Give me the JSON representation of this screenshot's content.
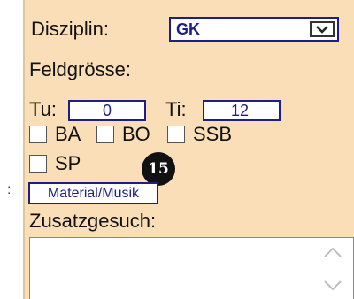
{
  "form": {
    "disziplin_label": "Disziplin:",
    "disziplin_value": "GK",
    "feldgroesse_label": "Feldgrösse:",
    "tu_label": "Tu:",
    "tu_value": "0",
    "ti_label": "Ti:",
    "ti_value": "12",
    "checkboxes": [
      {
        "label": "BA",
        "checked": false
      },
      {
        "label": "BO",
        "checked": false
      },
      {
        "label": "SSB",
        "checked": false
      },
      {
        "label": "SP",
        "checked": false
      }
    ],
    "badge_number": "15",
    "material_button": "Material/Musik",
    "zusatz_label": "Zusatzgesuch:",
    "zusatz_value": ""
  },
  "colors": {
    "panel_bg": "#f9deb7",
    "border_blue": "#1e1e8a"
  },
  "icons": {
    "dropdown": "chevron-down-icon",
    "scroll_up": "chevron-up-icon",
    "scroll_down": "chevron-down-icon"
  }
}
